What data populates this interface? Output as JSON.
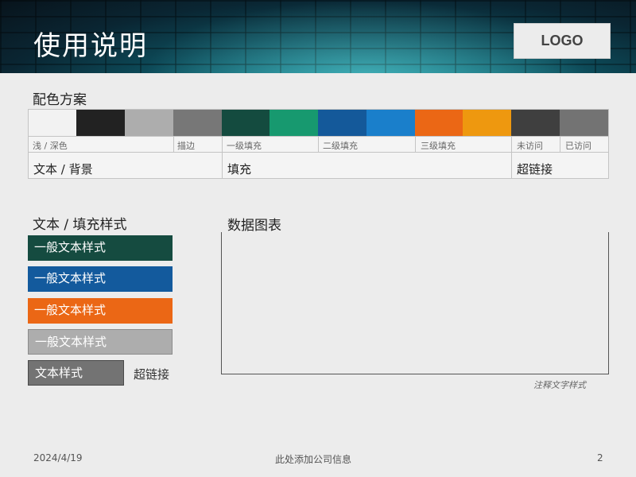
{
  "header": {
    "title": "使用说明",
    "logo_text": "LOGO"
  },
  "palette": {
    "title": "配色方案",
    "swatch_colors": [
      "#f2f2f2",
      "#222222",
      "#adadad",
      "#777777",
      "#144b3f",
      "#17996f",
      "#14599a",
      "#1a7fcb",
      "#eb6715",
      "#ee980f",
      "#3f3f3f",
      "#737373"
    ],
    "sub_labels": {
      "light_dark": "浅 / 深色",
      "stroke": "描边",
      "primary_fill": "一级填充",
      "secondary_fill": "二级填充",
      "tertiary_fill": "三级填充",
      "unvisited": "未访问",
      "visited": "已访问"
    },
    "group_labels": {
      "text_background": "文本 / 背景",
      "fill": "填充",
      "hyperlink": "超链接"
    }
  },
  "styles": {
    "title": "文本 / 填充样式",
    "boxes": [
      {
        "label": "一般文本样式",
        "color": "#154b40"
      },
      {
        "label": "一般文本样式",
        "color": "#135a9d"
      },
      {
        "label": "一般文本样式",
        "color": "#eb6715"
      },
      {
        "label": "一般文本样式",
        "color": "#adadad"
      }
    ],
    "text_style_box": {
      "label": "文本样式",
      "color": "#737373"
    },
    "hyperlink": "超链接"
  },
  "chart": {
    "title": "数据图表",
    "note": "注释文字样式"
  },
  "footer": {
    "date": "2024/4/19",
    "company": "此处添加公司信息",
    "page_number": "2"
  }
}
